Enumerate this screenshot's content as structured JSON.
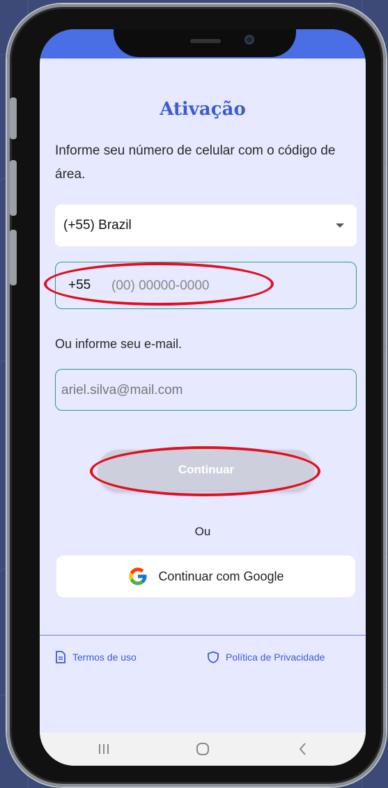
{
  "screen": {
    "title": "Ativação",
    "instructions": "Informe seu número de celular com o código de área.",
    "country_select": {
      "selected": "(+55) Brazil",
      "icon": "caret-down-icon"
    },
    "phone": {
      "prefix": "+55",
      "placeholder": "(00) 00000-0000",
      "value": ""
    },
    "email": {
      "label": "Ou informe seu e-mail.",
      "placeholder": "ariel.silva@mail.com",
      "value": ""
    },
    "continue_button": {
      "label": "Continuar",
      "state": "disabled"
    },
    "or_separator": "Ou",
    "google_button": {
      "label": "Continuar com Google",
      "icon": "google-icon"
    },
    "footer": {
      "terms": {
        "label": "Termos de uso",
        "icon": "document-icon"
      },
      "privacy": {
        "label": "Política de Privacidade",
        "icon": "shield-icon"
      }
    }
  },
  "navbar": {
    "icons": [
      "recent-apps-icon",
      "home-icon",
      "back-icon"
    ]
  },
  "colors": {
    "background": "#3d4a78",
    "screen": "#e6e9ff",
    "accent": "#3d5bd9",
    "topbar": "#4a6ee6",
    "field_border": "#2f9a84",
    "button_disabled": "#cdd0dc",
    "annotation": "#e01020"
  }
}
